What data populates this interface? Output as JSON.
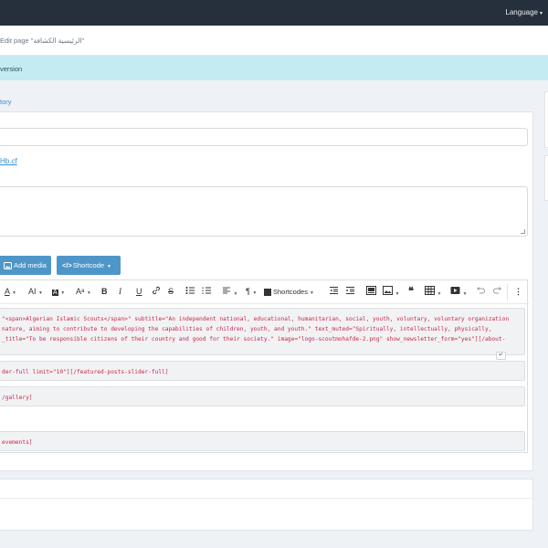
{
  "topbar": {
    "language_label": "Language",
    "caret": "▾"
  },
  "breadcrumb": {
    "text": "Edit page \"الرئيسية الكشافة\""
  },
  "alert": {
    "text": "version"
  },
  "history_link": "tory",
  "permalink": "Hb.cf",
  "buttons": {
    "add_media": "Add media",
    "shortcode": "Shortcode"
  },
  "toolbar": {
    "font_color_label": "A",
    "font_size_label": "AI",
    "highlight_label": "A",
    "case_label": "Aᵃ",
    "bold": "B",
    "italic": "I",
    "underline": "U",
    "strike": "S",
    "paragraph": "¶",
    "shortcodes_label": "Shortcodes",
    "quote": "❝",
    "menu": "⋮"
  },
  "editor": {
    "block1_lines": [
      "\"<span>Algerian Islamic Scouts</span>\" subtitle=\"An independent national, educational, humanitarian, social, youth, voluntary, voluntary organization",
      "nature, aiming to contribute to developing the capabilities of children, youth, and youth.\" text_muted=\"Spiritually, intellectually, physically,",
      "_title=\"To be responsible citizens of their country and good for their society.\" image=\"logo-scoutmohafde-2.png\" show_newsletter_form=\"yes\"][/about-"
    ],
    "block2": "der-full limit=\"10\"][/featured-posts-slider-full]",
    "block3": "/gallery]",
    "block4": "evements]"
  }
}
